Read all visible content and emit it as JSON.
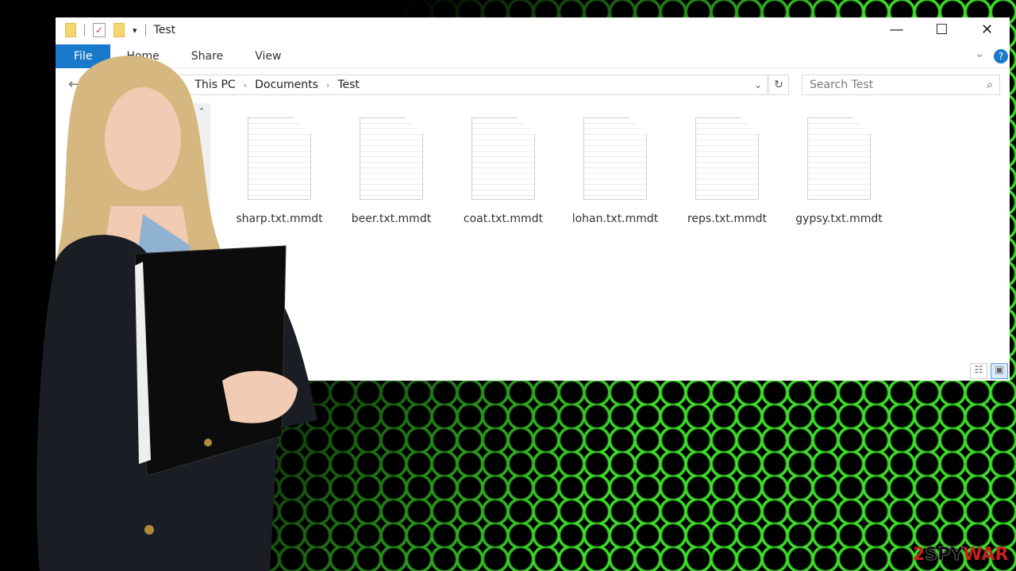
{
  "window": {
    "title": "Test",
    "controls": [
      "minimize",
      "maximize",
      "close"
    ]
  },
  "ribbon": {
    "tabs": [
      "File",
      "Home",
      "Share",
      "View"
    ]
  },
  "address": {
    "path": [
      "This PC",
      "Documents",
      "Test"
    ]
  },
  "search": {
    "placeholder": "Search Test"
  },
  "files": [
    {
      "name": "sharp.txt.mmdt"
    },
    {
      "name": "beer.txt.mmdt"
    },
    {
      "name": "coat.txt.mmdt"
    },
    {
      "name": "lohan.txt.mmdt"
    },
    {
      "name": "reps.txt.mmdt"
    },
    {
      "name": "gypsy.txt.mmdt"
    }
  ],
  "watermark": {
    "text": "2SPYWAR",
    "part1": "2",
    "part2": "SPY",
    "part3": "WAR"
  },
  "colors": {
    "accent": "#1979ca",
    "hex_green": "#3fe02a",
    "logo_red": "#c8201d"
  }
}
